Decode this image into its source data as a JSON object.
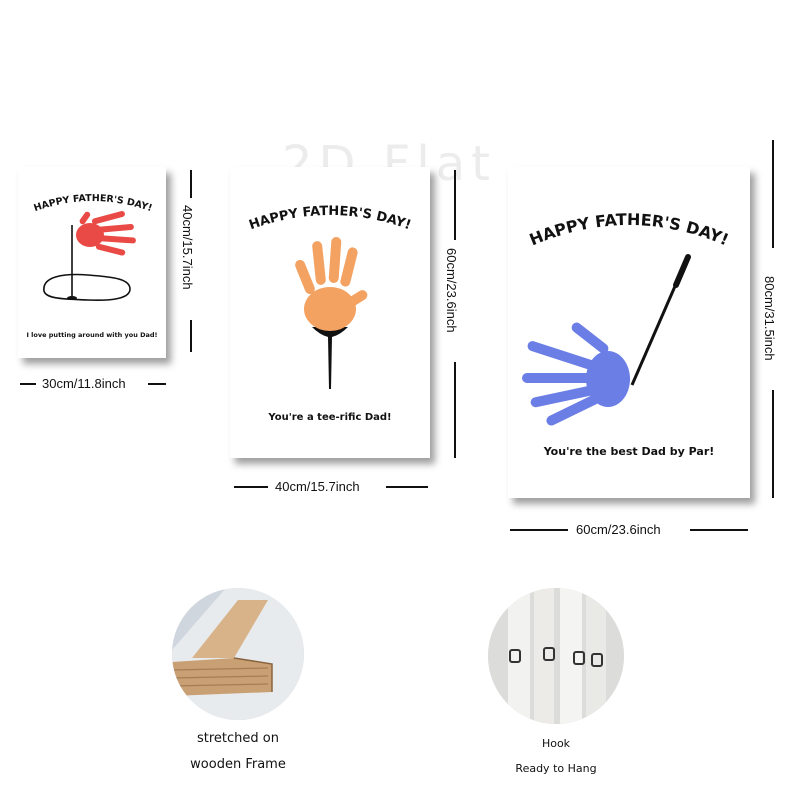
{
  "watermark": "2D Flat",
  "canvases": [
    {
      "title": "HAPPY FATHER'S DAY!",
      "message": "I love putting around with you Dad!",
      "width_label": "30cm/11.8inch",
      "height_label": "40cm/15.7inch",
      "hand_color": "#ea4a45"
    },
    {
      "title": "HAPPY FATHER'S DAY!",
      "message": "You're a tee-rific Dad!",
      "width_label": "40cm/15.7inch",
      "height_label": "60cm/23.6inch",
      "hand_color": "#f4a262"
    },
    {
      "title": "HAPPY FATHER'S DAY!",
      "message": "You're the best Dad by Par!",
      "width_label": "60cm/23.6inch",
      "height_label": "80cm/31.5inch",
      "hand_color": "#6b7ee6"
    }
  ],
  "features": [
    {
      "caption_line1": "stretched on",
      "caption_line2": "wooden Frame"
    },
    {
      "caption_line1": "Hook",
      "caption_line2": "Ready to Hang"
    }
  ]
}
